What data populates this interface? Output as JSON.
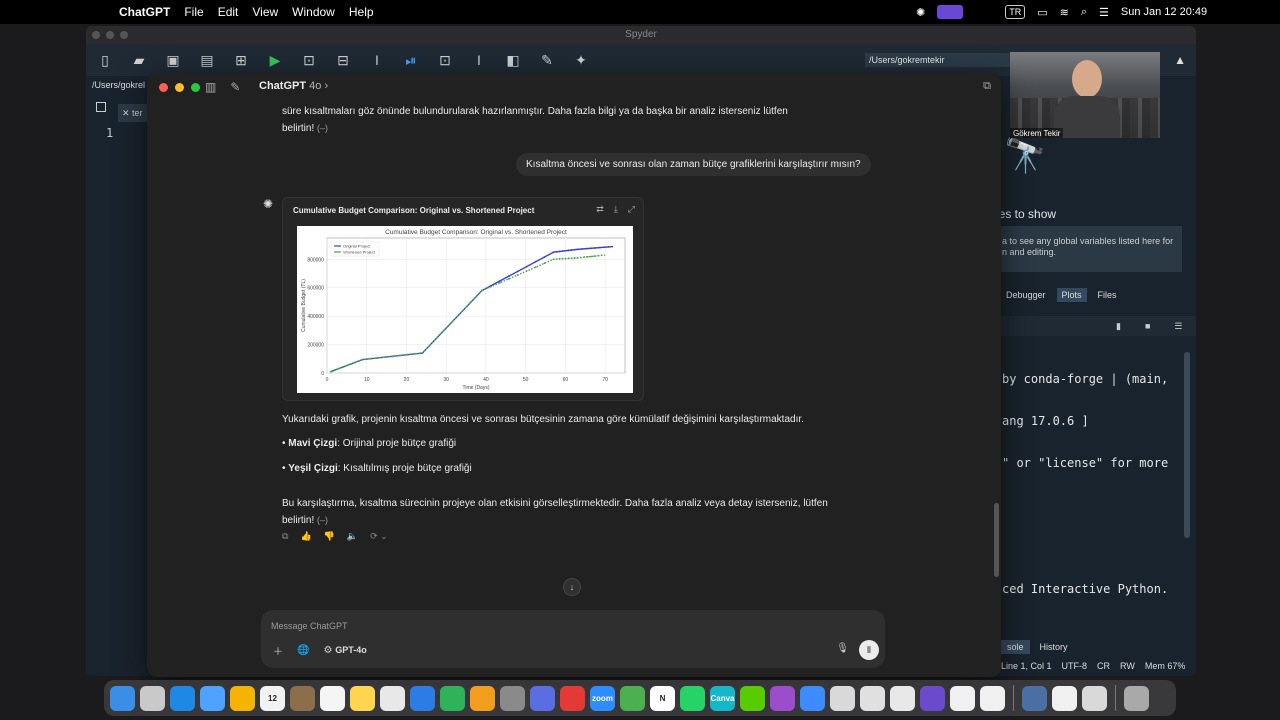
{
  "menubar": {
    "app_name": "ChatGPT",
    "menus": [
      "File",
      "Edit",
      "View",
      "Window",
      "Help"
    ],
    "input_source": "TR",
    "clock": "Sun Jan 12  20:49"
  },
  "spyder": {
    "window_title": "Spyder",
    "working_dir": "/Users/gokremtekir",
    "editor_path": "/Users/gokrel",
    "editor_tab": "ter",
    "line_number": "1",
    "variables_title": "les to show",
    "variables_hint_line1": "a to see any global variables listed here for",
    "variables_hint_line2": "n and editing.",
    "pane_tabs": [
      "Debugger",
      "Plots",
      "Files"
    ],
    "console_lines": [
      "by conda-forge | (main,",
      "ang 17.0.6 ]",
      "\" or \"license\" for more",
      "",
      "",
      "ced Interactive Python."
    ],
    "bottom_tabs": [
      "sole",
      "History"
    ],
    "status": [
      "Line 1, Col 1",
      "UTF-8",
      "CR",
      "RW",
      "Mem 67%"
    ]
  },
  "webcam": {
    "name": "Gökrem Tekir"
  },
  "chat": {
    "model_name": "ChatGPT",
    "model_version": "4o",
    "prev_text_line1": "süre kısaltmaları göz önünde bulundurularak hazırlanmıştır. Daha fazla bilgi ya da başka bir analiz isterseniz lütfen",
    "prev_text_line2": "belirtin!",
    "user_message": "Kısaltma öncesi ve sonrası olan zaman bütçe grafiklerini karşılaştırır mısın?",
    "chart_card_title": "Cumulative Budget Comparison: Original vs. Shortened Project",
    "answer_intro": "Yukarıdaki grafik, projenin kısaltma öncesi ve sonrası bütçesinin zamana göre kümülatif değişimini karşılaştırmaktadır.",
    "bullets": [
      {
        "bold": "Mavi Çizgi",
        "rest": ": Orijinal proje bütçe grafiği"
      },
      {
        "bold": "Yeşil Çizgi",
        "rest": ": Kısaltılmış proje bütçe grafiği"
      }
    ],
    "conclusion_line1": "Bu karşılaştırma, kısaltma sürecinin projeye olan etkisini görselleştirmektedir. Daha fazla analiz veya detay isterseniz, lütfen",
    "conclusion_line2": "belirtin!",
    "composer_placeholder": "Message ChatGPT",
    "composer_model": "GPT-4o"
  },
  "chart_data": {
    "type": "line",
    "title": "Cumulative Budget Comparison: Original vs. Shortened Project",
    "xlabel": "Time (Days)",
    "ylabel": "Cumulative Budget (TL)",
    "xlim": [
      0,
      75
    ],
    "ylim": [
      0,
      950000
    ],
    "xticks": [
      0,
      10,
      20,
      30,
      40,
      50,
      60,
      70
    ],
    "yticks": [
      0,
      200000,
      400000,
      600000,
      800000
    ],
    "ytick_labels": [
      "0",
      "200000",
      "400000",
      "600000",
      "800000"
    ],
    "legend_position": "top-left",
    "grid": true,
    "series": [
      {
        "name": "Original Project",
        "color": "#3a3fd6",
        "x": [
          1,
          9,
          24,
          39,
          57,
          63,
          72
        ],
        "y": [
          10000,
          95000,
          140000,
          580000,
          850000,
          870000,
          890000
        ]
      },
      {
        "name": "Shortened Project",
        "color": "#4aa84a",
        "x": [
          1,
          9,
          24,
          39,
          57,
          63,
          70
        ],
        "y": [
          10000,
          95000,
          140000,
          580000,
          800000,
          810000,
          830000
        ]
      }
    ]
  },
  "dock": {
    "apps": [
      {
        "label": "",
        "color": "#3a8ee6"
      },
      {
        "label": "",
        "color": "#c9c9c9"
      },
      {
        "label": "",
        "color": "#1e88e5"
      },
      {
        "label": "",
        "color": "#4da3ff"
      },
      {
        "label": "",
        "color": "#f4b400"
      },
      {
        "label": "12",
        "color": "#f2f2f2"
      },
      {
        "label": "",
        "color": "#8d6e4a"
      },
      {
        "label": "",
        "color": "#f5f5f5"
      },
      {
        "label": "",
        "color": "#ffd54f"
      },
      {
        "label": "",
        "color": "#e8e8e8"
      },
      {
        "label": "",
        "color": "#2d7be5"
      },
      {
        "label": "",
        "color": "#2fb35a"
      },
      {
        "label": "",
        "color": "#f29d1c"
      },
      {
        "label": "",
        "color": "#8a8a8a"
      },
      {
        "label": "",
        "color": "#5b6ee1"
      },
      {
        "label": "",
        "color": "#e53935"
      },
      {
        "label": "zoom",
        "color": "#2d8cff"
      },
      {
        "label": "",
        "color": "#4caf50"
      },
      {
        "label": "N",
        "color": "#ffffff"
      },
      {
        "label": "",
        "color": "#25d366"
      },
      {
        "label": "Canva",
        "color": "#14b8c8"
      },
      {
        "label": "",
        "color": "#58cc02"
      },
      {
        "label": "",
        "color": "#9c4dcc"
      },
      {
        "label": "",
        "color": "#3d8bfd"
      },
      {
        "label": "",
        "color": "#d9d9d9"
      },
      {
        "label": "",
        "color": "#e0e0e0"
      },
      {
        "label": "",
        "color": "#e8e8e8"
      },
      {
        "label": "",
        "color": "#6b4bcc"
      },
      {
        "label": "",
        "color": "#f0f0f0"
      },
      {
        "label": "",
        "color": "#f0f0f0"
      },
      {
        "label": "",
        "color": "#4a6fa5"
      },
      {
        "label": "",
        "color": "#f0f0f0"
      },
      {
        "label": "",
        "color": "#d9d9d9"
      },
      {
        "label": "",
        "color": "#a9a9a9"
      }
    ]
  }
}
